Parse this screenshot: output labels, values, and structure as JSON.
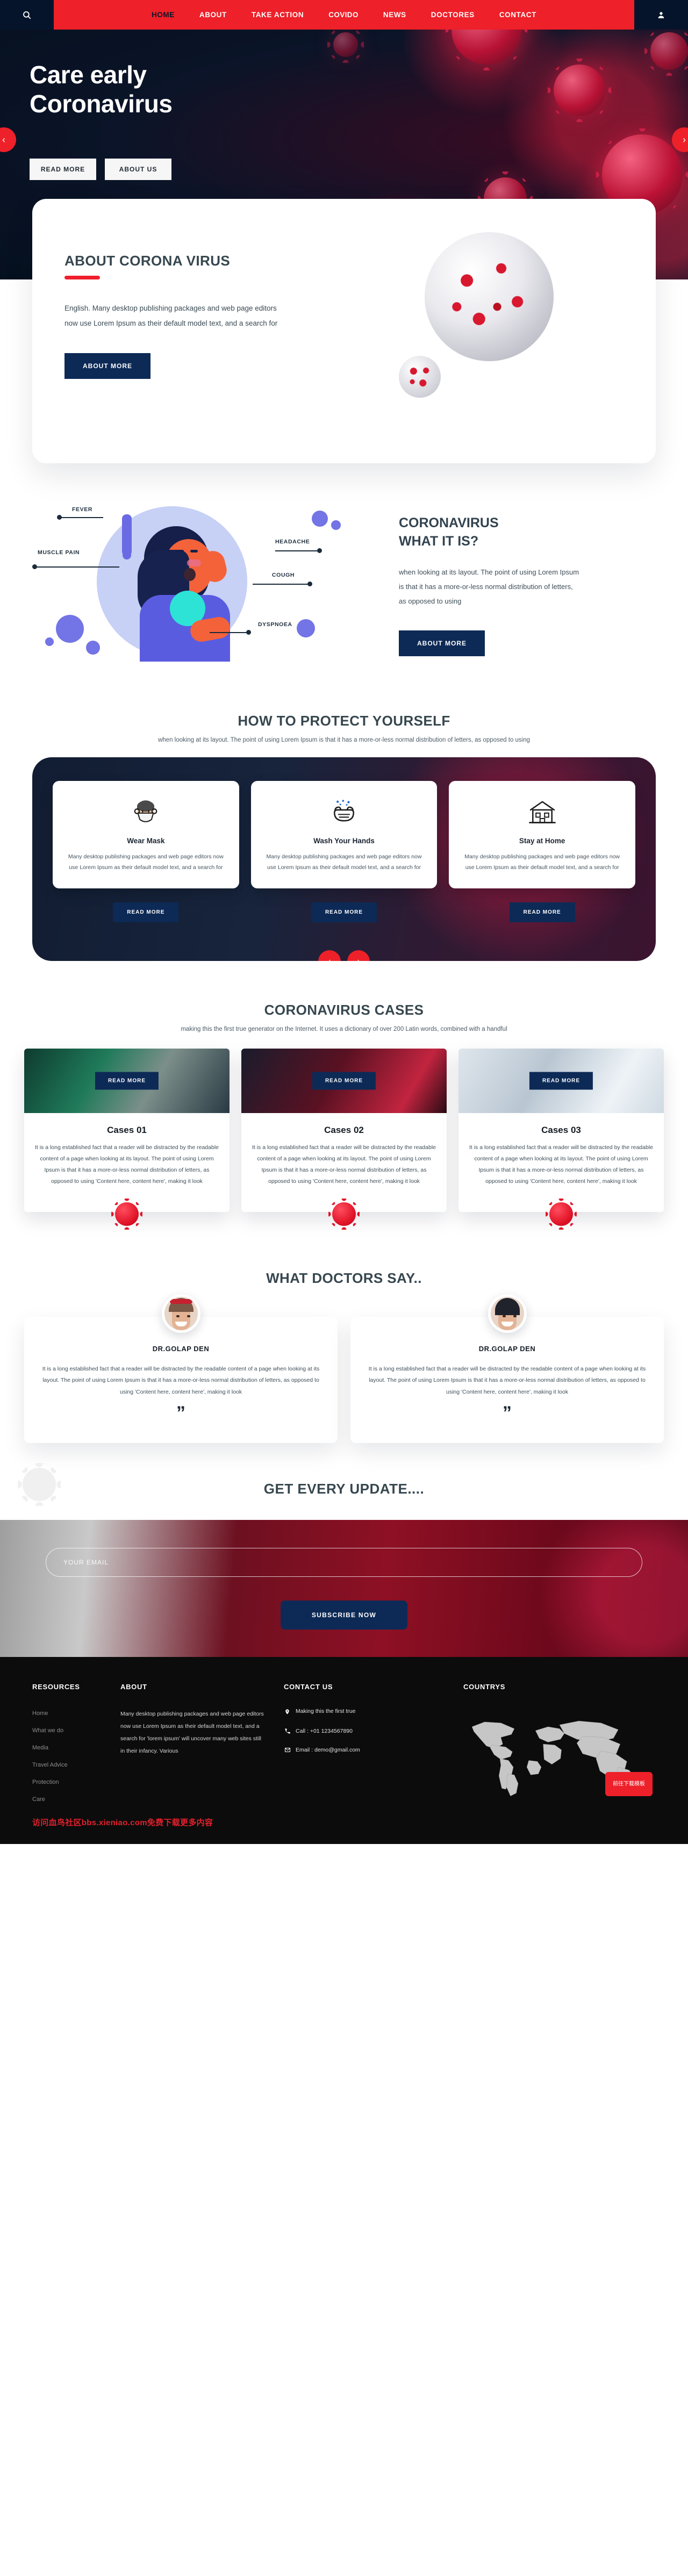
{
  "nav": {
    "search_icon": "search-icon",
    "user_icon": "user-icon",
    "items": [
      {
        "label": "HOME",
        "active": false
      },
      {
        "label": "ABOUT",
        "active": false
      },
      {
        "label": "TAKE ACTION",
        "active": false
      },
      {
        "label": "COVIDO",
        "active": true
      },
      {
        "label": "NEWS",
        "active": false
      },
      {
        "label": "DOCTORES",
        "active": false
      },
      {
        "label": "CONTACT",
        "active": false
      }
    ]
  },
  "hero": {
    "title_line1": "Care early",
    "title_line2": "Coronavirus",
    "btn_read_more": "READ MORE",
    "btn_about_us": "ABOUT US",
    "prev_arrow": "‹",
    "next_arrow": "›"
  },
  "about": {
    "title": "ABOUT CORONA VIRUS",
    "paragraph": "English. Many desktop publishing packages and web page editors now use Lorem Ipsum as their default model text, and a search for",
    "button": "ABOUT MORE"
  },
  "whatis": {
    "title_line1": "CORONAVIRUS",
    "title_line2": "WHAT IT IS?",
    "paragraph": "when looking at its layout. The point of using Lorem Ipsum is that it has a more-or-less normal distribution of letters, as opposed to using",
    "button": "ABOUT MORE",
    "labels": {
      "fever": "FEVER",
      "muscle_pain": "MUSCLE PAIN",
      "headache": "HEADACHE",
      "cough": "COUGH",
      "dyspnoea": "DYSPNOEA"
    }
  },
  "protect": {
    "title": "HOW TO PROTECT YOURSELF",
    "subtitle": "when looking at its layout. The point of using Lorem Ipsum is that it has a more-or-less normal distribution of letters, as opposed to using",
    "cards": [
      {
        "icon": "face-mask-icon",
        "title": "Wear Mask",
        "text": "Many desktop publishing packages and web page editors now use Lorem Ipsum as their default model text, and a search for",
        "button": "READ MORE"
      },
      {
        "icon": "washing-hands-icon",
        "title": "Wash Your Hands",
        "text": "Many desktop publishing packages and web page editors now use Lorem Ipsum as their default model text, and a search for",
        "button": "READ MORE"
      },
      {
        "icon": "house-icon",
        "title": "Stay at Home",
        "text": "Many desktop publishing packages and web page editors now use Lorem Ipsum as their default model text, and a search for",
        "button": "READ MORE"
      }
    ],
    "prev_arrow": "‹",
    "next_arrow": "›"
  },
  "cases": {
    "title": "CORONAVIRUS CASES",
    "subtitle": "making this the first true generator on the Internet. It uses a dictionary of over 200 Latin words, combined with a handful",
    "items": [
      {
        "overlay_button": "READ MORE",
        "title": "Cases 01",
        "text": "It is a long established fact that a reader will be distracted by the readable content of a page when looking at its layout. The point of using Lorem Ipsum is that it has a more-or-less normal distribution of letters, as opposed to using 'Content here, content here', making it look"
      },
      {
        "overlay_button": "READ MORE",
        "title": "Cases 02",
        "text": "It is a long established fact that a reader will be distracted by the readable content of a page when looking at its layout. The point of using Lorem Ipsum is that it has a more-or-less normal distribution of letters, as opposed to using 'Content here, content here', making it look"
      },
      {
        "overlay_button": "READ MORE",
        "title": "Cases 03",
        "text": "It is a long established fact that a reader will be distracted by the readable content of a page when looking at its layout. The point of using Lorem Ipsum is that it has a more-or-less normal distribution of letters, as opposed to using 'Content here, content here', making it look"
      }
    ]
  },
  "doctors": {
    "title": "WHAT DOCTORS SAY..",
    "items": [
      {
        "avatar": "doctor-avatar",
        "name": "DR.GOLAP DEN",
        "text": "It is a long established fact that a reader will be distracted by the readable content of a page when looking at its layout. The point of using Lorem Ipsum is that it has a more-or-less normal distribution of letters, as opposed to using 'Content here, content here', making it look",
        "quote": "”"
      },
      {
        "avatar": "doctor-avatar",
        "name": "DR.GOLAP DEN",
        "text": "It is a long established fact that a reader will be distracted by the readable content of a page when looking at its layout. The point of using Lorem Ipsum is that it has a more-or-less normal distribution of letters, as opposed to using 'Content here, content here', making it look",
        "quote": "”"
      }
    ]
  },
  "newsletter": {
    "title": "GET EVERY UPDATE....",
    "email_placeholder": "YOUR EMAIL",
    "email_value": "",
    "button": "SUBSCRIBE NOW"
  },
  "footer": {
    "resources": {
      "heading": "RESOURCES",
      "links": [
        "Home",
        "What we do",
        "Media",
        "Travel Advice",
        "Protection",
        "Care"
      ]
    },
    "about": {
      "heading": "ABOUT",
      "text": "Many desktop publishing packages and web page editors now use Lorem Ipsum as their default model text, and a search for 'lorem ipsum' will uncover many web sites still in their infancy. Various"
    },
    "contact": {
      "heading": "CONTACT US",
      "address_icon": "location-pin-icon",
      "address": "Making this the first true",
      "phone_icon": "phone-icon",
      "phone": "Call : +01 1234567890",
      "email_icon": "mail-icon",
      "email": "Email : demo@gmail.com"
    },
    "countries": {
      "heading": "COUNTRYS",
      "map_icon": "world-map-icon",
      "download_button": "前往下载模板"
    },
    "watermark": "访问血鸟社区bbs.xieniao.com免费下载更多内容"
  },
  "colors": {
    "brand_red": "#ee2029",
    "navy": "#0d2a56",
    "dark": "#06142b",
    "slate": "#37474f"
  }
}
